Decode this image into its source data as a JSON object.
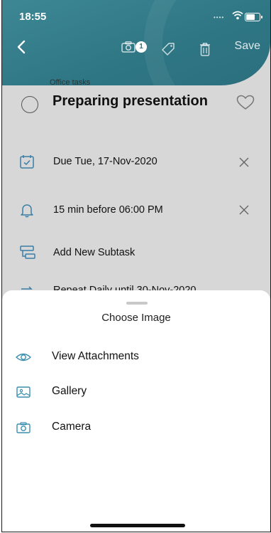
{
  "status": {
    "time": "18:55"
  },
  "header": {
    "attachment_count": "1",
    "save_label": "Save",
    "icons": [
      "back-chevron-icon",
      "camera-icon",
      "tag-icon",
      "trash-icon"
    ]
  },
  "task": {
    "category": "Office tasks",
    "title": "Preparing presentation",
    "due": "Due Tue, 17-Nov-2020",
    "reminder": "15 min before 06:00 PM",
    "subtask": "Add New Subtask",
    "repeat_partial": "Repeat Daily until 30-Nov-2020"
  },
  "sheet": {
    "title": "Choose Image",
    "items": [
      {
        "label": "View Attachments",
        "icon": "eye-icon"
      },
      {
        "label": "Gallery",
        "icon": "gallery-icon"
      },
      {
        "label": "Camera",
        "icon": "camera-icon"
      }
    ]
  },
  "colors": {
    "header": "#2f7684",
    "accent": "#3a8fb0",
    "dim_bg": "#d7d7d7"
  }
}
